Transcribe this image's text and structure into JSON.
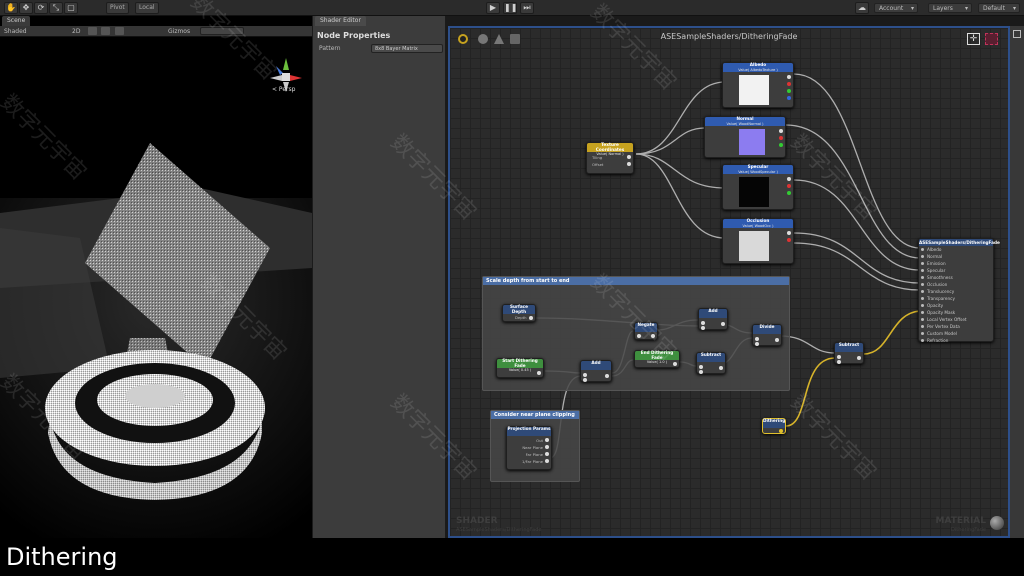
{
  "toolbar": {
    "pivot": "Pivot",
    "local": "Local",
    "layers": "Layers",
    "layout": "Default",
    "account": "Account"
  },
  "scene": {
    "tab": "Scene",
    "shaded": "Shaded",
    "mode_2d": "2D",
    "gizmos": "Gizmos",
    "persp": "< Persp"
  },
  "inspector": {
    "tab": "Shader Editor",
    "title": "Node Properties",
    "pattern_label": "Pattern",
    "pattern_value": "8x8 Bayer Matrix"
  },
  "canvas": {
    "title": "ASESampleShaders/DitheringFade",
    "bottom_left_big": "SHADER",
    "bottom_left_small": "ASESampleShaders/DitheringFade",
    "bottom_right_big": "MATERIAL",
    "bottom_right_small": "DitheringFade"
  },
  "nodes": {
    "albedo": {
      "title": "Albedo",
      "sub": "Value( AlbedoTexture )"
    },
    "normal": {
      "title": "Normal",
      "sub": "Value( WoodNormal )"
    },
    "specular": {
      "title": "Specular",
      "sub": "Value( WoodSpecular )"
    },
    "occlusion": {
      "title": "Occlusion",
      "sub": "Value( WoodOcc )"
    },
    "texcoords": {
      "title": "Texture Coordinates",
      "sub": "Value( Normal )",
      "tiling": "Tiling",
      "offset": "Offset"
    },
    "surface_depth": {
      "title": "Surface Depth",
      "pin": "Depth"
    },
    "start_fade": {
      "title": "Start Dithering Fade",
      "sub": "Value( 0.45 )"
    },
    "add1": {
      "title": "Add"
    },
    "negate": {
      "title": "Negate"
    },
    "add2": {
      "title": "Add"
    },
    "end_fade": {
      "title": "End Dithering Fade",
      "sub": "Value( 1.0 )"
    },
    "subtract1": {
      "title": "Subtract"
    },
    "divide": {
      "title": "Divide"
    },
    "subtract2": {
      "title": "Subtract"
    },
    "dithering": {
      "title": "Dithering"
    },
    "projection": {
      "title": "Projection Params",
      "pins": [
        "Out",
        "Near Plane",
        "Far Plane",
        "1/Far Plane"
      ]
    },
    "master": {
      "title": "ASESampleShaders/DitheringFade",
      "pins": [
        "Albedo",
        "Normal",
        "Emission",
        "Specular",
        "Smoothness",
        "Occlusion",
        "Translucency",
        "Transparency",
        "Opacity",
        "Opacity Mask",
        "Local Vertex Offset",
        "Per Vertex Data",
        "Custom Model",
        "Refraction"
      ]
    }
  },
  "groups": {
    "scale": "Scale depth from start to end",
    "clip": "Consider near plane clipping"
  },
  "caption": "Dithering",
  "watermark": "数字元宇宙"
}
